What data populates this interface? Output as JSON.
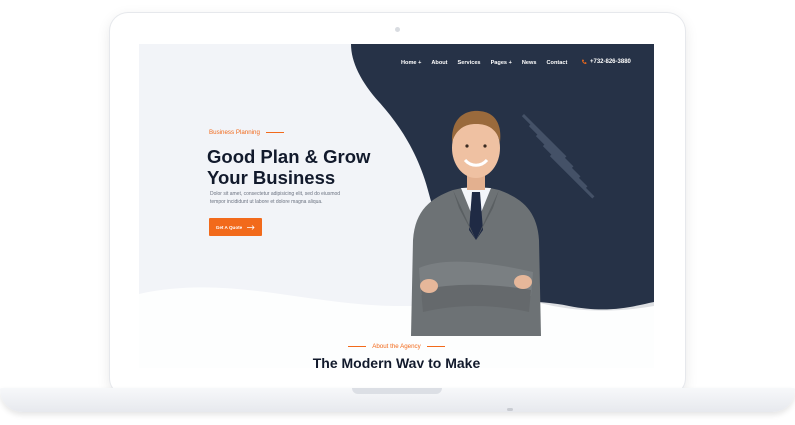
{
  "nav": {
    "items": [
      "Home +",
      "About",
      "Services",
      "Pages +",
      "News",
      "Contact"
    ],
    "phone": "+732-826-3880",
    "phone_icon": "phone-icon"
  },
  "hero": {
    "eyebrow": "Business Planning",
    "title_line1": "Good Plan & Grow",
    "title_line2": "Your Business",
    "description": "Dolor sit amet, consectetur adipisicing elit, sed do eiusmod tempor incididunt ut labore et dolore magna aliqua.",
    "cta_label": "Get A Quote",
    "cta_icon": "arrow-right-icon"
  },
  "about": {
    "eyebrow": "About the Agency",
    "title": "The Modern Way to Make"
  },
  "colors": {
    "accent": "#f26a1b",
    "dark_navy": "#263247",
    "heading": "#121a2c",
    "screen_bg": "#f2f4f8"
  }
}
